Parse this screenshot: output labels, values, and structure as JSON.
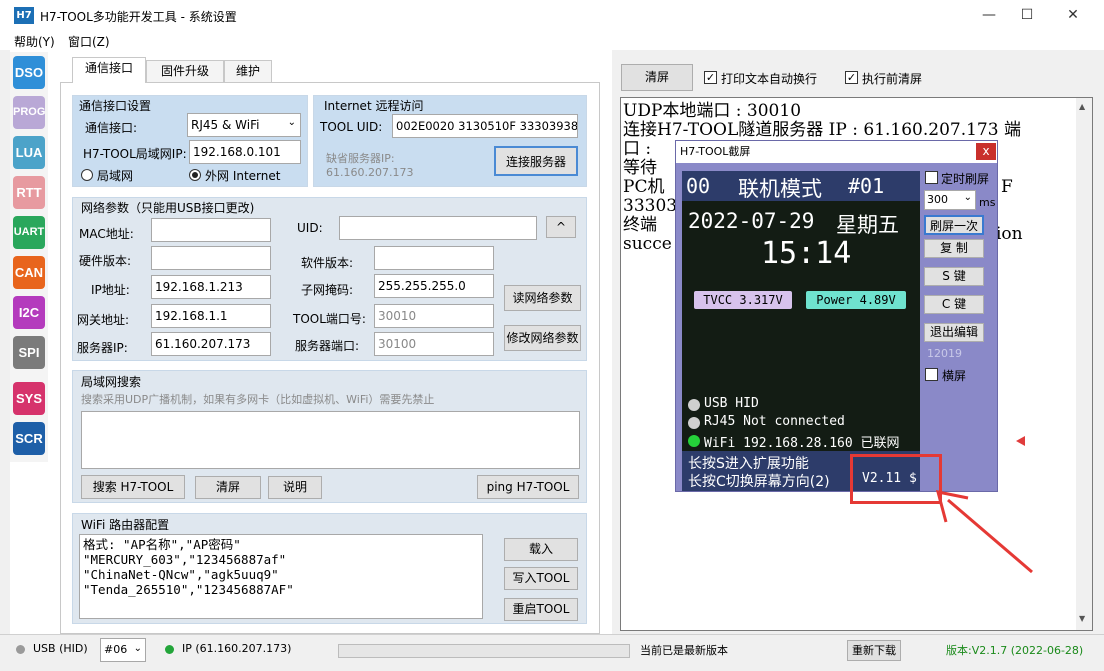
{
  "window": {
    "app_icon_text": "H7",
    "title": "H7-TOOL多功能开发工具 - 系统设置",
    "minimize": "—",
    "maximize": "☐",
    "close": "✕"
  },
  "menu": {
    "help": "帮助(Y)",
    "window": "窗口(Z)"
  },
  "sidebar": {
    "items": [
      {
        "label": "DSO",
        "color": "#2f8fd8"
      },
      {
        "label": "PROG",
        "color": "#b9a8d6"
      },
      {
        "label": "LUA",
        "color": "#4ca3c9"
      },
      {
        "label": "RTT",
        "color": "#e79aa0"
      },
      {
        "label": "UART",
        "color": "#2aa75c"
      },
      {
        "label": "CAN",
        "color": "#e8651d"
      },
      {
        "label": "I2C",
        "color": "#b43bbd"
      },
      {
        "label": "SPI",
        "color": "#7b7b7b"
      },
      {
        "label": "SYS",
        "color": "#d6336c"
      },
      {
        "label": "SCR",
        "color": "#1e5fa8"
      }
    ]
  },
  "tabs": {
    "comm": "通信接口",
    "firmware": "固件升级",
    "maintain": "维护"
  },
  "comm_settings": {
    "title": "通信接口设置",
    "iface_label": "通信接口:",
    "iface_value": "RJ45 & WiFi",
    "lan_ip_label": "H7-TOOL局域网IP:",
    "lan_ip_value": "192.168.0.101",
    "radio_lan": "局域网",
    "radio_wan": "外网 Internet"
  },
  "internet": {
    "title": "Internet 远程访问",
    "uid_label": "TOOL UID:",
    "uid_value": "002E0020 3130510F 33303938",
    "connect_button": "连接服务器",
    "default_server_label": "缺省服务器IP:",
    "default_server_value": "61.160.207.173"
  },
  "network": {
    "title": "网络参数（只能用USB接口更改)",
    "mac_label": "MAC地址:",
    "mac_value": "",
    "uid_label": "UID:",
    "uid_value": "",
    "caret_button": "^",
    "hw_label": "硬件版本:",
    "hw_value": "",
    "sw_label": "软件版本:",
    "sw_value": "",
    "ip_label": "IP地址:",
    "ip_value": "192.168.1.213",
    "mask_label": "子网掩码:",
    "mask_value": "255.255.255.0",
    "read_button": "读网络参数",
    "gw_label": "网关地址:",
    "gw_value": "192.168.1.1",
    "port_label": "TOOL端口号:",
    "port_value": "30010",
    "modify_button": "修改网络参数",
    "server_label": "服务器IP:",
    "server_value": "61.160.207.173",
    "server_port_label": "服务器端口:",
    "server_port_value": "30100"
  },
  "lan_search": {
    "title": "局域网搜索",
    "hint": "搜索采用UDP广播机制，如果有多网卡（比如虚拟机、WiFi）需要先禁止",
    "search_button": "搜索 H7-TOOL",
    "clear_button": "清屏",
    "help_button": "说明",
    "ping_button": "ping H7-TOOL"
  },
  "wifi": {
    "title": "WiFi 路由器配置",
    "lines": [
      "格式: \"AP名称\",\"AP密码\"",
      "\"MERCURY_603\",\"123456887af\"",
      "\"ChinaNet-QNcw\",\"agk5uuq9\"",
      "\"Tenda_265510\",\"123456887AF\""
    ],
    "load_button": "载入",
    "write_button": "写入TOOL",
    "restart_button": "重启TOOL"
  },
  "right": {
    "clear_button": "清屏",
    "autowrap_label": "打印文本自动换行",
    "clear_before_label": "执行前清屏",
    "console_lines": [
      "UDP本地端口 : 30010",
      "连接H7-TOOL隧道服务器 IP : 61.160.207.173 端",
      "口 :",
      "等待",
      "PC机",
      "33303",
      "终端",
      "succe"
    ],
    "console_tail": [
      "F",
      "ion"
    ]
  },
  "capture": {
    "title": "H7-TOOL截屏",
    "close": "x",
    "lcd": {
      "num": "00",
      "mode": "联机模式",
      "id": "#01",
      "date": "2022-07-29",
      "weekday": "星期五",
      "time": "15:14",
      "tvcc": "TVCC 3.317V",
      "power": "Power 4.89V",
      "usb": "USB HID",
      "rj45": "RJ45 Not connected",
      "wifi": "WiFi 192.168.28.160 已联网",
      "hint1": "长按S进入扩展功能",
      "hint2": "长按C切换屏幕方向(2)",
      "version": "V2.11 $"
    },
    "timed_refresh": "定时刷屏",
    "interval": "300",
    "ms": "ms",
    "refresh_once": "刷屏一次",
    "copy": "复 制",
    "s_key": "S 键",
    "c_key": "C 键",
    "exit_edit": "退出编辑",
    "counter": "12019",
    "landscape": "横屏"
  },
  "status": {
    "usb": "USB (HID)",
    "port": "#06",
    "ip": "IP (61.160.207.173)",
    "latest": "当前已是最新版本",
    "redownload": "重新下载",
    "version": "版本:V2.1.7 (2022-06-28)"
  }
}
